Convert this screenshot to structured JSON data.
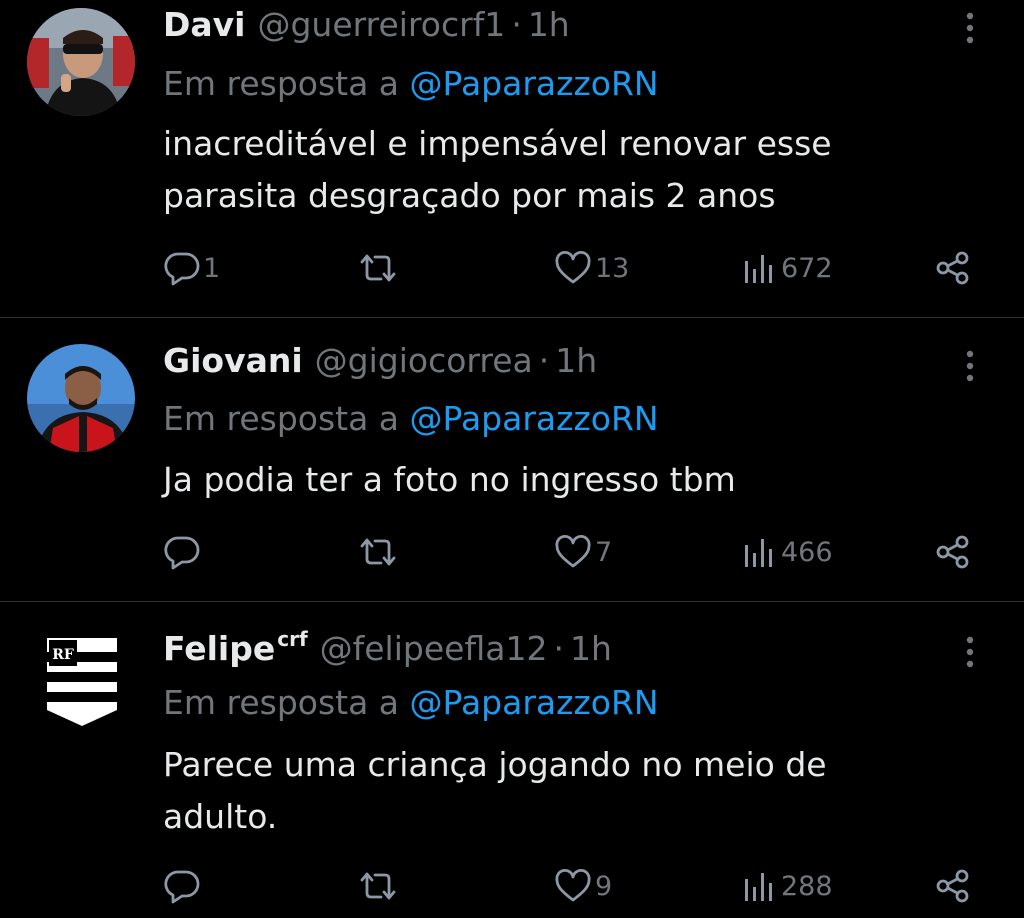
{
  "reply_prefix": "Em resposta a",
  "tweets": [
    {
      "name": "Davi",
      "name_sup": "",
      "handle": "@guerreirocrf1",
      "separator": "·",
      "time": "1h",
      "reply_to": "@PaparazzoRN",
      "text_lines": [
        "inacreditável e impensável renovar esse",
        "parasita desgraçado por mais 2 anos"
      ],
      "replies": "1",
      "retweets": "",
      "likes": "13",
      "views": "672"
    },
    {
      "name": "Giovani",
      "name_sup": "",
      "handle": "@gigiocorrea",
      "separator": "·",
      "time": "1h",
      "reply_to": "@PaparazzoRN",
      "text_lines": [
        "Ja podia ter a foto no ingresso tbm"
      ],
      "replies": "",
      "retweets": "",
      "likes": "7",
      "views": "466"
    },
    {
      "name": "Felipe",
      "name_sup": "crf",
      "handle": "@felipeefla12",
      "separator": "·",
      "time": "1h",
      "reply_to": "@PaparazzoRN",
      "text_lines": [
        "Parece uma criança jogando no meio de",
        "adulto."
      ],
      "replies": "",
      "retweets": "",
      "likes": "9",
      "views": "288"
    }
  ],
  "icons": {
    "reply": "reply-icon",
    "retweet": "retweet-icon",
    "like": "heart-icon",
    "views": "views-chart-icon",
    "share": "share-icon",
    "more": "more-vertical-icon"
  },
  "colors": {
    "background": "#000000",
    "text": "#e7e9ea",
    "muted": "#71767b",
    "mention": "#1d9bf0",
    "divider": "#2f3336"
  }
}
